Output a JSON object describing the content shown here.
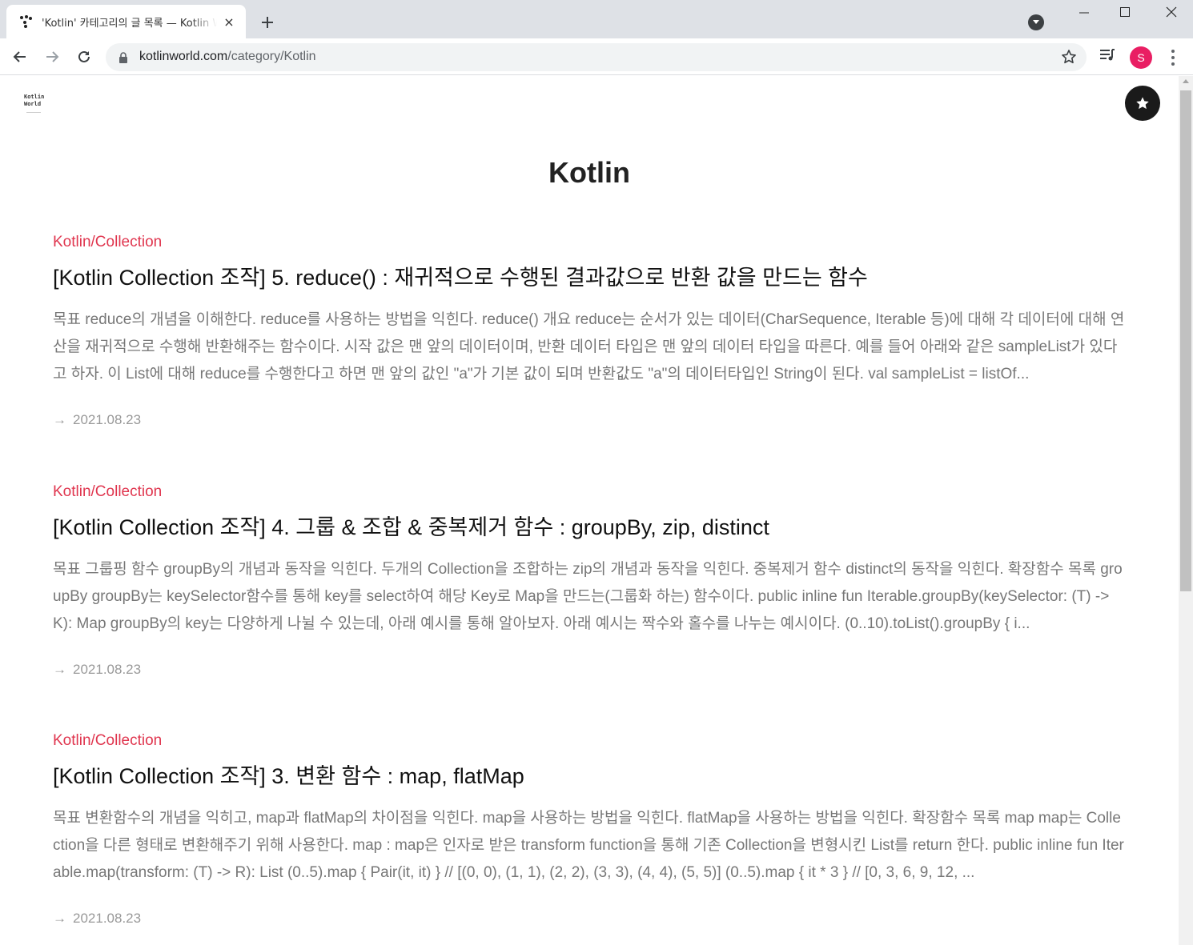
{
  "browser": {
    "tab_title": "'Kotlin' 카테고리의 글 목록 — Kotlin World",
    "url_host": "kotlinworld.com",
    "url_path": "/category/Kotlin",
    "profile_initial": "S",
    "new_tab_label": "+",
    "close_tab_label": "×"
  },
  "site": {
    "logo_line1": "Kotlin",
    "logo_line2": "World",
    "category_title": "Kotlin"
  },
  "posts": [
    {
      "category": "Kotlin/Collection",
      "title": "[Kotlin Collection 조작] 5. reduce() : 재귀적으로 수행된 결과값으로 반환 값을 만드는 함수",
      "excerpt": "목표 reduce의 개념을 이해한다. reduce를 사용하는 방법을 익힌다. reduce() 개요 reduce는 순서가 있는 데이터(CharSequence, Iterable 등)에 대해 각 데이터에 대해 연산을 재귀적으로 수행해 반환해주는 함수이다. 시작 값은 맨 앞의 데이터이며, 반환 데이터 타입은 맨 앞의 데이터 타입을 따른다. 예를 들어 아래와 같은 sampleList가 있다고 하자. 이 List에 대해 reduce를 수행한다고 하면 맨 앞의 값인 \"a\"가 기본 값이 되며 반환값도 \"a\"의 데이터타입인 String이 된다. val sampleList = listOf...",
      "date": "2021.08.23"
    },
    {
      "category": "Kotlin/Collection",
      "title": "[Kotlin Collection 조작] 4. 그룹 & 조합 & 중복제거 함수 : groupBy, zip, distinct",
      "excerpt": "목표 그룹핑 함수 groupBy의 개념과 동작을 익힌다. 두개의 Collection을 조합하는 zip의 개념과 동작을 익힌다. 중복제거 함수 distinct의 동작을 익힌다. 확장함수 목록 groupBy groupBy는 keySelector함수를 통해 key를 select하여 해당 Key로 Map을 만드는(그룹화 하는) 함수이다. public inline fun Iterable.groupBy(keySelector: (T) -> K): Map groupBy의 key는 다양하게 나뉠 수 있는데, 아래 예시를 통해 알아보자. 아래 예시는 짝수와 홀수를 나누는 예시이다. (0..10).toList().groupBy { i...",
      "date": "2021.08.23"
    },
    {
      "category": "Kotlin/Collection",
      "title": "[Kotlin Collection 조작] 3. 변환 함수 : map, flatMap",
      "excerpt": "목표 변환함수의 개념을 익히고, map과 flatMap의 차이점을 익힌다. map을 사용하는 방법을 익힌다. flatMap을 사용하는 방법을 익힌다. 확장함수 목록 map map는 Collection을 다른 형태로 변환해주기 위해 사용한다. map : map은 인자로 받은 transform function을 통해 기존 Collection을 변형시킨 List를 return 한다. public inline fun Iterable.map(transform: (T) -> R): List (0..5).map { Pair(it, it) } // [(0, 0), (1, 1), (2, 2), (3, 3), (4, 4), (5, 5)] (0..5).map { it * 3 } // [0, 3, 6, 9, 12, ...",
      "date": "2021.08.23"
    }
  ],
  "date_arrow": "→",
  "colors": {
    "accent": "#e0364f",
    "profile": "#e91e63",
    "tabbar": "#dee1e6"
  }
}
